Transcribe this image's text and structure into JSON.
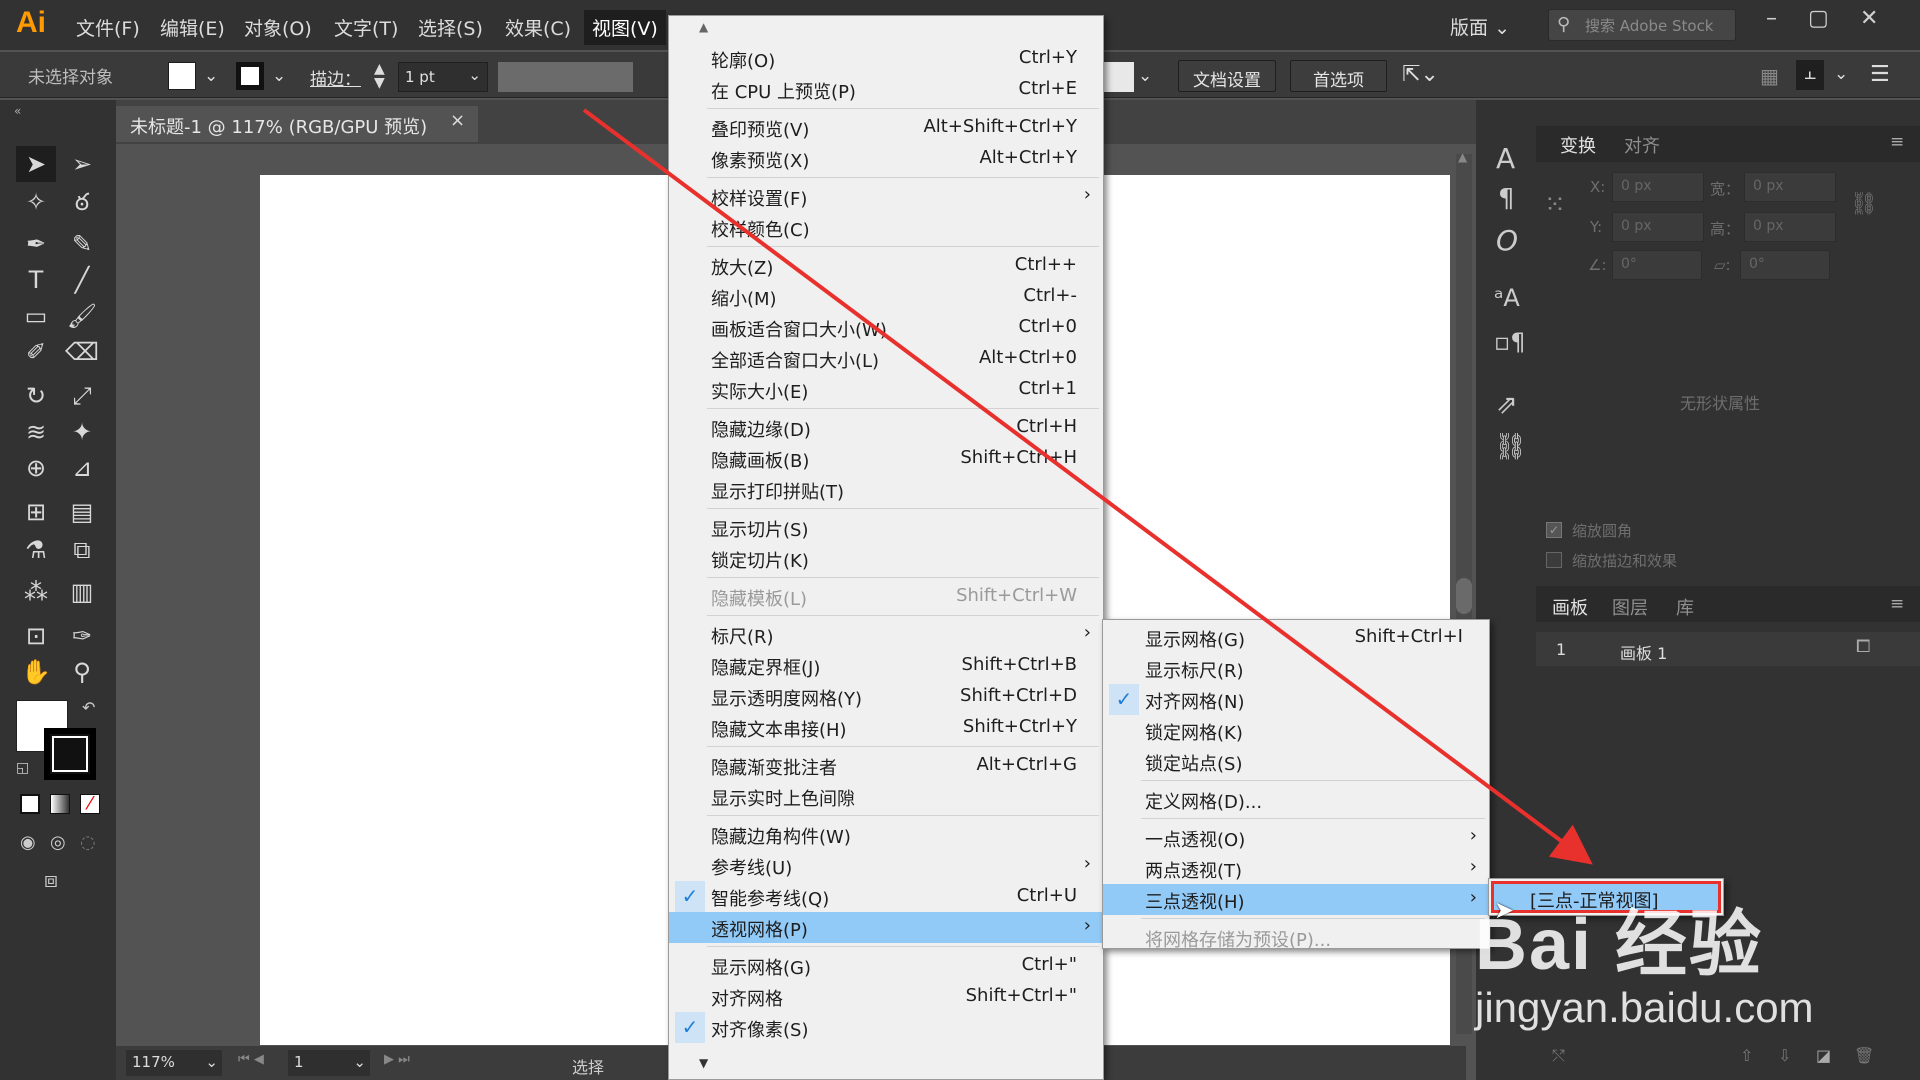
{
  "app": {
    "logo": "Ai"
  },
  "menubar": {
    "items": [
      "文件(F)",
      "编辑(E)",
      "对象(O)",
      "文字(T)",
      "选择(S)",
      "效果(C)",
      "视图(V)"
    ],
    "workspace": "版面",
    "stock_search_placeholder": "搜索 Adobe Stock"
  },
  "controlbar": {
    "no_selection": "未选择对象",
    "stroke_label": "描边：",
    "stroke_value": "1 pt",
    "doc_setup": "文档设置",
    "preferences": "首选项"
  },
  "document": {
    "tab_title": "未标题-1 @ 117% (RGB/GPU 预览)",
    "close_glyph": "×"
  },
  "status": {
    "zoom": "117%",
    "artboard": "1",
    "mode": "选择"
  },
  "view_menu": {
    "items": [
      {
        "label": "轮廓(O)",
        "shortcut": "Ctrl+Y"
      },
      {
        "label": "在 CPU 上预览(P)",
        "shortcut": "Ctrl+E"
      },
      {
        "label": "叠印预览(V)",
        "shortcut": "Alt+Shift+Ctrl+Y"
      },
      {
        "label": "像素预览(X)",
        "shortcut": "Alt+Ctrl+Y"
      },
      {
        "label": "校样设置(F)",
        "shortcut": "",
        "submenu": true
      },
      {
        "label": "校样颜色(C)",
        "shortcut": ""
      },
      {
        "label": "放大(Z)",
        "shortcut": "Ctrl++"
      },
      {
        "label": "缩小(M)",
        "shortcut": "Ctrl+-"
      },
      {
        "label": "画板适合窗口大小(W)",
        "shortcut": "Ctrl+0"
      },
      {
        "label": "全部适合窗口大小(L)",
        "shortcut": "Alt+Ctrl+0"
      },
      {
        "label": "实际大小(E)",
        "shortcut": "Ctrl+1"
      },
      {
        "label": "隐藏边缘(D)",
        "shortcut": "Ctrl+H"
      },
      {
        "label": "隐藏画板(B)",
        "shortcut": "Shift+Ctrl+H"
      },
      {
        "label": "显示打印拼贴(T)",
        "shortcut": ""
      },
      {
        "label": "显示切片(S)",
        "shortcut": ""
      },
      {
        "label": "锁定切片(K)",
        "shortcut": ""
      },
      {
        "label": "隐藏模板(L)",
        "shortcut": "Shift+Ctrl+W",
        "disabled": true
      },
      {
        "label": "标尺(R)",
        "shortcut": "",
        "submenu": true
      },
      {
        "label": "隐藏定界框(J)",
        "shortcut": "Shift+Ctrl+B"
      },
      {
        "label": "显示透明度网格(Y)",
        "shortcut": "Shift+Ctrl+D"
      },
      {
        "label": "隐藏文本串接(H)",
        "shortcut": "Shift+Ctrl+Y"
      },
      {
        "label": "隐藏渐变批注者",
        "shortcut": "Alt+Ctrl+G"
      },
      {
        "label": "显示实时上色间隙",
        "shortcut": ""
      },
      {
        "label": "隐藏边角构件(W)",
        "shortcut": ""
      },
      {
        "label": "参考线(U)",
        "shortcut": "",
        "submenu": true
      },
      {
        "label": "智能参考线(Q)",
        "shortcut": "Ctrl+U",
        "checked": true
      },
      {
        "label": "透视网格(P)",
        "shortcut": "",
        "submenu": true,
        "highlighted": true
      },
      {
        "label": "显示网格(G)",
        "shortcut": "Ctrl+\""
      },
      {
        "label": "对齐网格",
        "shortcut": "Shift+Ctrl+\""
      },
      {
        "label": "对齐像素(S)",
        "shortcut": "",
        "checked": true
      }
    ]
  },
  "perspective_menu": {
    "items": [
      {
        "label": "显示网格(G)",
        "shortcut": "Shift+Ctrl+I"
      },
      {
        "label": "显示标尺(R)",
        "shortcut": ""
      },
      {
        "label": "对齐网格(N)",
        "shortcut": "",
        "checked": true
      },
      {
        "label": "锁定网格(K)",
        "shortcut": ""
      },
      {
        "label": "锁定站点(S)",
        "shortcut": ""
      },
      {
        "label": "定义网格(D)...",
        "shortcut": ""
      },
      {
        "label": "一点透视(O)",
        "shortcut": "",
        "submenu": true
      },
      {
        "label": "两点透视(T)",
        "shortcut": "",
        "submenu": true
      },
      {
        "label": "三点透视(H)",
        "shortcut": "",
        "submenu": true,
        "highlighted": true
      },
      {
        "label": "将网格存储为预设(P)...",
        "shortcut": "",
        "disabled": true
      }
    ]
  },
  "three_point_menu": {
    "item": "[三点-正常视图]"
  },
  "right_panel": {
    "tabs_top": [
      "变换",
      "对齐"
    ],
    "x_label": "X:",
    "y_label": "Y:",
    "w_label": "宽：",
    "h_label": "高：",
    "x_value": "0 px",
    "y_value": "0 px",
    "w_value": "0 px",
    "h_value": "0 px",
    "angle_value": "0°",
    "shear_value": "0°",
    "no_shape": "无形状属性",
    "scale_corners": "缩放圆角",
    "scale_strokes": "缩放描边和效果",
    "tabs_bottom": [
      "画板",
      "图层",
      "库"
    ],
    "artboard_num": "1",
    "artboard_name": "画板 1"
  },
  "watermark": {
    "line1": "Bai 经验",
    "line2": "jingyan.baidu.com"
  },
  "colors": {
    "annotation_arrow": "#e8312c",
    "menu_highlight": "#91c9f7",
    "selection_box": "#e8312c"
  }
}
